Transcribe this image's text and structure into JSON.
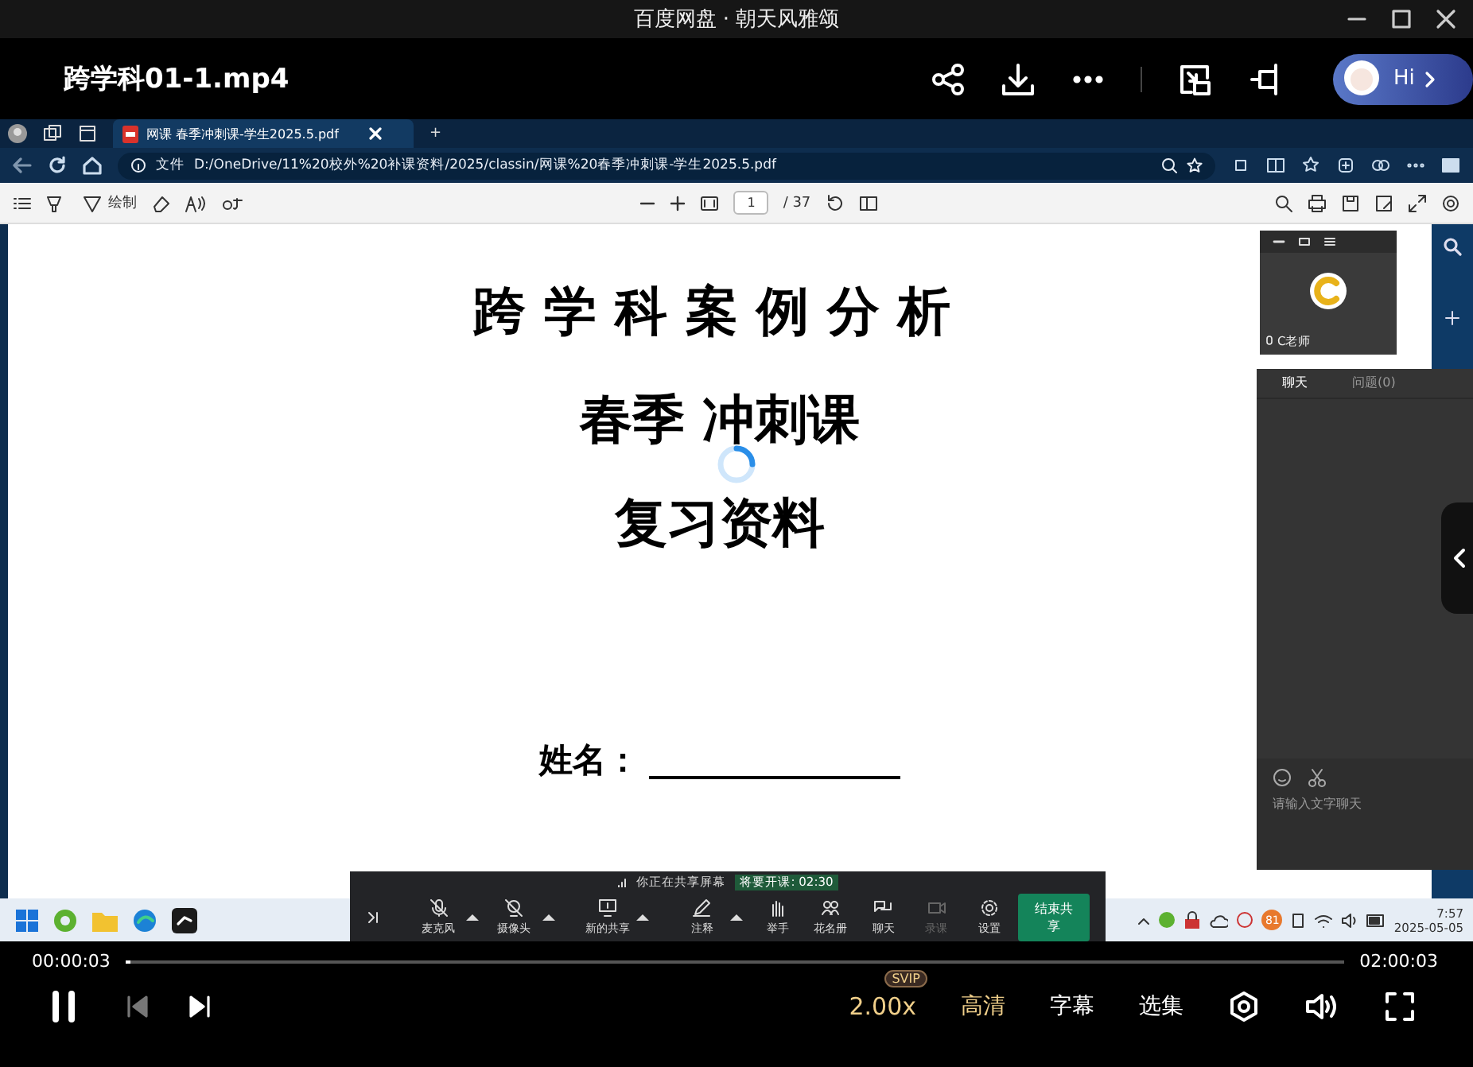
{
  "window": {
    "title": "百度网盘 · 朝天风雅颂"
  },
  "header": {
    "file_name": "跨学科01-1.mp4",
    "assistant_button": "Hi"
  },
  "video_frame": {
    "browser": {
      "tab_title": "网课 春季冲刺课-学生2025.5.pdf",
      "new_tab": "+",
      "address_label": "文件",
      "address": "D:/OneDrive/11%20校外%20补课资料/2025/classin/网课%20春季冲刺课-学生2025.5.pdf"
    },
    "pdf_toolbar": {
      "draw_label": "绘制",
      "page": "1",
      "page_count": "/ 37"
    },
    "pdf_page": {
      "lines": [
        "跨 学 科 案 例 分 析",
        "春季 冲刺课",
        "复习资料"
      ],
      "name_label": "姓名："
    },
    "teacher_video": {
      "name": "C老师"
    },
    "chat": {
      "tabs": [
        {
          "label": "聊天",
          "selected": true
        },
        {
          "label": "问题(0)",
          "selected": false
        }
      ],
      "placeholder": "请输入文字聊天"
    },
    "share_bar": {
      "status": "你正在共享屏幕",
      "countdown": "将要开课: 02:30",
      "tools": [
        {
          "kind": "mic",
          "label": "麦克风",
          "menu": true,
          "disabled": false
        },
        {
          "kind": "camera",
          "label": "摄像头",
          "menu": true,
          "disabled": false
        },
        {
          "kind": "share",
          "label": "新的共享",
          "menu": true,
          "disabled": false
        },
        {
          "kind": "pen",
          "label": "注释",
          "menu": true,
          "disabled": false
        },
        {
          "kind": "hand",
          "label": "举手",
          "menu": false,
          "disabled": false
        },
        {
          "kind": "people",
          "label": "花名册",
          "menu": false,
          "disabled": false
        },
        {
          "kind": "chat",
          "label": "聊天",
          "menu": false,
          "disabled": false
        },
        {
          "kind": "record",
          "label": "录课",
          "menu": false,
          "disabled": true
        },
        {
          "kind": "gear",
          "label": "设置",
          "menu": false,
          "disabled": false
        }
      ],
      "end_button": "结束共享"
    },
    "taskbar": {
      "badge": "81",
      "time": "7:57",
      "date": "2025-05-05"
    }
  },
  "playback": {
    "elapsed": "00:00:03",
    "duration": "02:00:03",
    "level": 0.003,
    "playing": true,
    "speed": "2.00x",
    "speed_badge": "SVIP",
    "quality": "高清",
    "subtitles": "字幕",
    "episodes": "选集"
  }
}
